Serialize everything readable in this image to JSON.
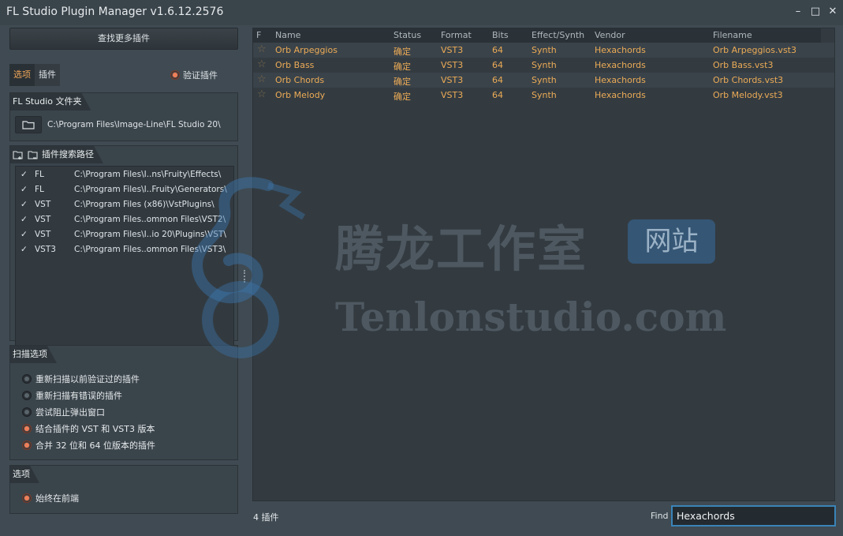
{
  "window": {
    "title": "FL Studio Plugin Manager v1.6.12.2576",
    "controls": [
      "minimize-icon",
      "maximize-icon",
      "close-icon"
    ]
  },
  "left": {
    "find_more_button": "查找更多插件",
    "tabs": [
      {
        "label": "选项",
        "active": true
      },
      {
        "label": "插件",
        "active": false
      }
    ],
    "verify_plugins": {
      "label": "验证插件",
      "checked": true
    },
    "fl_folder": {
      "header": "FL Studio 文件夹",
      "path": "C:\\Program Files\\Image-Line\\FL Studio 20\\"
    },
    "search_paths": {
      "header": "插件搜索路径",
      "rows": [
        {
          "check": "✓",
          "type": "FL",
          "path": "C:\\Program Files\\I..ns\\Fruity\\Effects\\"
        },
        {
          "check": "✓",
          "type": "FL",
          "path": "C:\\Program Files\\I..Fruity\\Generators\\"
        },
        {
          "check": "✓",
          "type": "VST",
          "path": "C:\\Program Files (x86)\\VstPlugins\\"
        },
        {
          "check": "✓",
          "type": "VST",
          "path": "C:\\Program Files..ommon Files\\VST2\\"
        },
        {
          "check": "✓",
          "type": "VST",
          "path": "C:\\Program Files\\I..io 20\\Plugins\\VST\\"
        },
        {
          "check": "✓",
          "type": "VST3",
          "path": "C:\\Program Files..ommon Files\\VST3\\"
        }
      ]
    },
    "scan_options": {
      "header": "扫描选项",
      "items": [
        {
          "label": "重新扫描以前验证过的插件",
          "checked": false
        },
        {
          "label": "重新扫描有错误的插件",
          "checked": false
        },
        {
          "label": "尝试阻止弹出窗口",
          "checked": false
        },
        {
          "label": "结合插件的 VST 和 VST3 版本",
          "checked": true
        },
        {
          "label": "合并 32 位和 64 位版本的插件",
          "checked": true
        }
      ]
    },
    "options": {
      "header": "选项",
      "items": [
        {
          "label": "始终在前端",
          "checked": true
        }
      ]
    }
  },
  "grid": {
    "columns": [
      "F",
      "Name",
      "Status",
      "Format",
      "Bits",
      "Effect/Synth",
      "Vendor",
      "Filename"
    ],
    "rows": [
      {
        "name": "Orb Arpeggios",
        "status": "确定",
        "format": "VST3",
        "bits": "64",
        "kind": "Synth",
        "vendor": "Hexachords",
        "filename": "Orb Arpeggios.vst3"
      },
      {
        "name": "Orb Bass",
        "status": "确定",
        "format": "VST3",
        "bits": "64",
        "kind": "Synth",
        "vendor": "Hexachords",
        "filename": "Orb Bass.vst3"
      },
      {
        "name": "Orb Chords",
        "status": "确定",
        "format": "VST3",
        "bits": "64",
        "kind": "Synth",
        "vendor": "Hexachords",
        "filename": "Orb Chords.vst3"
      },
      {
        "name": "Orb Melody",
        "status": "确定",
        "format": "VST3",
        "bits": "64",
        "kind": "Synth",
        "vendor": "Hexachords",
        "filename": "Orb Melody.vst3"
      }
    ]
  },
  "footer": {
    "count": "4 插件",
    "find_label": "Find",
    "find_value": "Hexachords"
  },
  "watermark": {
    "cn": "腾龙工作室",
    "badge": "网站",
    "en": "Tenlonstudio.com"
  },
  "colors": {
    "accent_orange": "#ecab56",
    "radio_on": "#ef7f5a",
    "focus_blue": "#3a83b8"
  }
}
